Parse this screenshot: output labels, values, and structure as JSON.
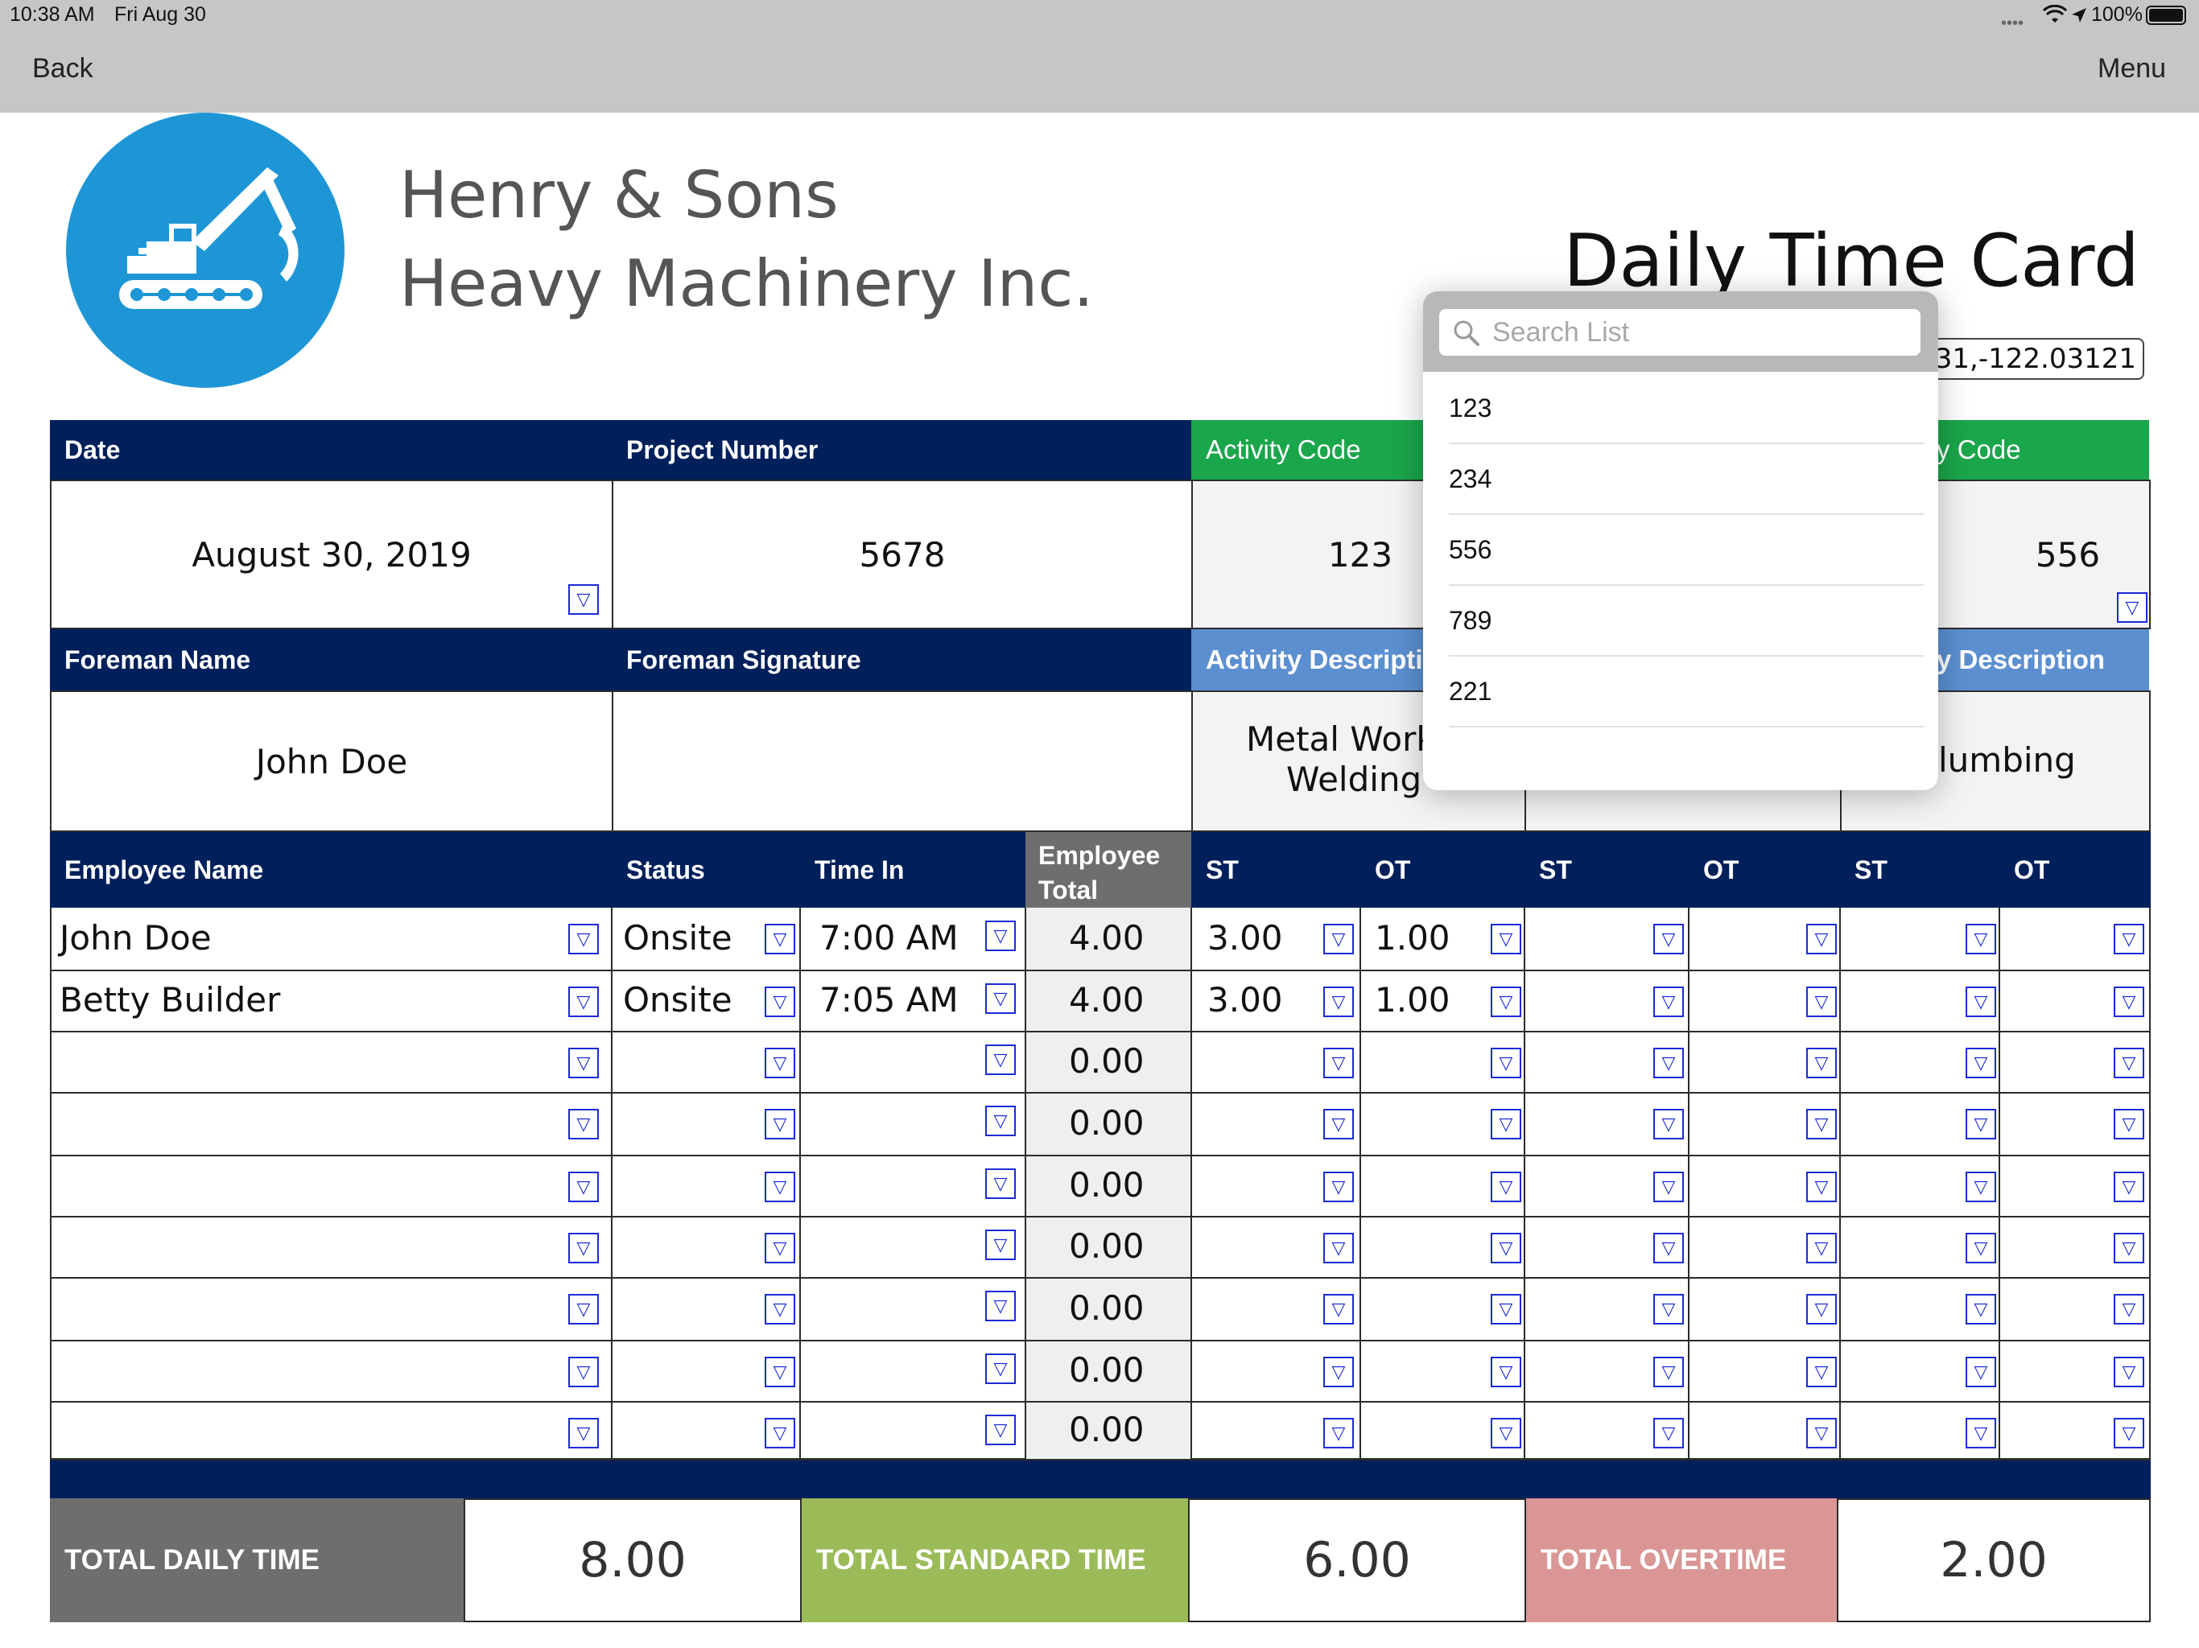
{
  "status_bar": {
    "time": "10:38 AM",
    "date": "Fri Aug 30",
    "battery": "100%",
    "icons": [
      "signal-dots-icon",
      "wifi-icon",
      "location-arrow-icon",
      "battery-icon"
    ]
  },
  "nav": {
    "back_label": "Back",
    "menu_label": "Menu"
  },
  "company": {
    "line1": "Henry & Sons",
    "line2": "Heavy Machinery Inc.",
    "logo_icon": "excavator-icon"
  },
  "doc_title": "Daily Time Card",
  "gps_value": "31,-122.03121",
  "header_fields": {
    "date_label": "Date",
    "date_value": "August 30, 2019",
    "project_label": "Project Number",
    "project_value": "5678",
    "activity1_label": "Activity Code",
    "activity1_value": "123",
    "activity3_label": "y Code",
    "activity3_value": "556",
    "foreman_label": "Foreman Name",
    "foreman_value": "John Doe",
    "signature_label": "Foreman Signature",
    "desc1_label": "Activity Descripti",
    "desc1_line1": "Metal Work",
    "desc1_line2": "Welding",
    "desc3_label": "y Description",
    "desc3_value": "lumbing"
  },
  "table": {
    "headers": {
      "name": "Employee Name",
      "status": "Status",
      "time_in": "Time In",
      "emp_total_1": "Employee",
      "emp_total_2": "Total",
      "st": "ST",
      "ot": "OT"
    },
    "rows": [
      {
        "name": "John Doe",
        "status": "Onsite",
        "time_in": "7:00 AM",
        "total": "4.00",
        "st1": "3.00",
        "ot1": "1.00"
      },
      {
        "name": "Betty Builder",
        "status": "Onsite",
        "time_in": "7:05 AM",
        "total": "4.00",
        "st1": "3.00",
        "ot1": "1.00"
      },
      {
        "name": "",
        "status": "",
        "time_in": "",
        "total": "0.00",
        "st1": "",
        "ot1": ""
      },
      {
        "name": "",
        "status": "",
        "time_in": "",
        "total": "0.00",
        "st1": "",
        "ot1": ""
      },
      {
        "name": "",
        "status": "",
        "time_in": "",
        "total": "0.00",
        "st1": "",
        "ot1": ""
      },
      {
        "name": "",
        "status": "",
        "time_in": "",
        "total": "0.00",
        "st1": "",
        "ot1": ""
      },
      {
        "name": "",
        "status": "",
        "time_in": "",
        "total": "0.00",
        "st1": "",
        "ot1": ""
      },
      {
        "name": "",
        "status": "",
        "time_in": "",
        "total": "0.00",
        "st1": "",
        "ot1": ""
      },
      {
        "name": "",
        "status": "",
        "time_in": "",
        "total": "0.00",
        "st1": "",
        "ot1": ""
      }
    ]
  },
  "totals": {
    "daily_label": "TOTAL DAILY TIME",
    "daily_value": "8.00",
    "standard_label": "TOTAL STANDARD TIME",
    "standard_value": "6.00",
    "overtime_label": "TOTAL OVERTIME",
    "overtime_value": "2.00",
    "colors": {
      "daily": "#6e6e6e",
      "standard": "#9bbb59",
      "overtime": "#d99694"
    }
  },
  "popover": {
    "search_placeholder": "Search List",
    "items": [
      "123",
      "234",
      "556",
      "789",
      "221"
    ]
  },
  "dropdown_glyph": "▽"
}
